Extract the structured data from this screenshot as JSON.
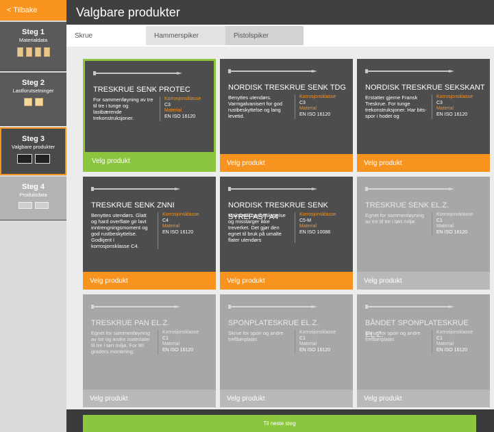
{
  "sidebar": {
    "back_label": "< Tilbake",
    "steps": [
      {
        "title": "Steg 1",
        "subtitle": "Materialdata"
      },
      {
        "title": "Steg 2",
        "subtitle": "Lastforutsetninger"
      },
      {
        "title": "Steg 3",
        "subtitle": "Valgbare produkter"
      },
      {
        "title": "Steg 4",
        "subtitle": "Produktdata"
      }
    ]
  },
  "header": {
    "title": "Valgbare produkter"
  },
  "tabs": [
    {
      "label": "Skrue"
    },
    {
      "label": "Hammerspiker"
    },
    {
      "label": "Pistolspiker"
    }
  ],
  "products": [
    {
      "title": "TRESKRUE SENK PROTEC",
      "desc": "For sammenføyning av tre til tre i tunge og lastbærende trekonstruksjoner.",
      "spec1_label": "Korrosjonsklasse",
      "spec1_value": "C3",
      "spec2_label": "Material",
      "spec2_value": "EN ISO 16120",
      "button": "Velg produkt"
    },
    {
      "title": "NORDISK TRESKRUE SENK TDG",
      "desc": "Benyttes utendørs. Varmgalvanisert for god rustbeskyttelse og lang levetid.",
      "spec1_label": "Korrosjonsklasse",
      "spec1_value": "C3",
      "spec2_label": "Material",
      "spec2_value": "EN ISO 16120",
      "button": "Velg produkt"
    },
    {
      "title": "NORDISK TRESKRUE SEKSKANT",
      "desc": "Erstatter gjerne Fransk Treskrue. For tunge trekonstruksjoner. Har bits-spor i hodet og",
      "spec1_label": "Korrosjonsklasse",
      "spec1_value": "C3",
      "spec2_label": "Material",
      "spec2_value": "EN ISO 16120",
      "button": "Velg produkt"
    },
    {
      "title": "TRESKRUE SENK ZNNI",
      "desc": "Benyttes utendørs. Glatt og hard overflate gir lavt inntrengningsmoment og god rustbeskyttelse. Godkjent i korrosjonsklasse C4.",
      "spec1_label": "Korrosjonsklasse",
      "spec1_value": "C4",
      "spec2_label": "Material",
      "spec2_value": "EN ISO 16120",
      "button": "Velg produkt"
    },
    {
      "title": "NORDISK TRESKRUE SENK SYREFAST A4",
      "desc": "Maksimal rustbeskyttelse og misstarger ikke treverket. Det gjør den egnet til bruk på umalte flater utendørs",
      "spec1_label": "Korrosjonsklasse",
      "spec1_value": "C5-M",
      "spec2_label": "Material",
      "spec2_value": "EN ISO 10088",
      "button": "Velg produkt"
    },
    {
      "title": "TRESKRUE SENK EL.Z.",
      "desc": "Egnet for sammenføyning av tre til tre i tørt miljø.",
      "spec1_label": "Korrosjonsklasse",
      "spec1_value": "C1",
      "spec2_label": "Material",
      "spec2_value": "EN ISO 16120",
      "button": "Velg produkt"
    },
    {
      "title": "TRESKRUE PAN EL.Z.",
      "desc": "Egnet for sammenføyning av tre og andre materialer til tre i tørt miljø. For 90 graders montering.",
      "spec1_label": "Korrosjonsklasse",
      "spec1_value": "C1",
      "spec2_label": "Material",
      "spec2_value": "EN ISO 16120",
      "button": "Velg produkt"
    },
    {
      "title": "SPONPLATESKRUE EL.Z.",
      "desc": "Skrue for spon og andre treflberplater.",
      "spec1_label": "Korrosjonsklasse",
      "spec1_value": "C1",
      "spec2_label": "Material",
      "spec2_value": "EN ISO 16120",
      "button": "Velg produkt"
    },
    {
      "title": "BÅNDET SPONPLATESKRUE EL.Z.",
      "desc": "Skrue for spon og andre treflberplater.",
      "spec1_label": "Korrosjonsklasse",
      "spec1_value": "C1",
      "spec2_label": "Material",
      "spec2_value": "EN ISO 16120",
      "button": "Velg produkt"
    }
  ],
  "footer": {
    "next_label": "Til neste steg"
  },
  "colors": {
    "accent": "#f7931e",
    "selected": "#8cc63f",
    "dark": "#4d4d4d",
    "light": "#a7a7a7"
  }
}
